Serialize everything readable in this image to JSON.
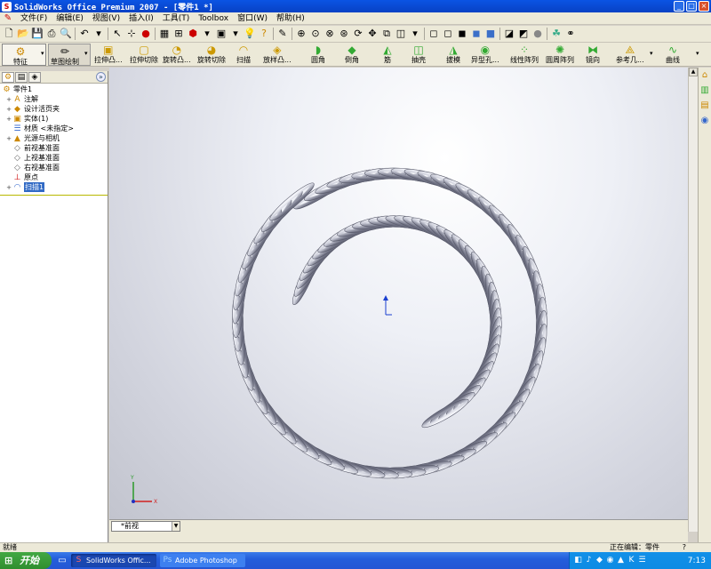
{
  "window": {
    "title": "SolidWorks Office Premium 2007 - [零件1 *]"
  },
  "menu": [
    "文件(F)",
    "编辑(E)",
    "视图(V)",
    "插入(I)",
    "工具(T)",
    "Toolbox",
    "窗口(W)",
    "帮助(H)"
  ],
  "commands": {
    "tabs": {
      "features": "特征",
      "sketch": "草图绘制"
    },
    "items": [
      {
        "label": "拉伸凸...",
        "icon": "extrude-boss-icon"
      },
      {
        "label": "拉伸切除",
        "icon": "extrude-cut-icon"
      },
      {
        "label": "旋转凸...",
        "icon": "revolve-boss-icon"
      },
      {
        "label": "旋转切除",
        "icon": "revolve-cut-icon"
      },
      {
        "label": "扫描",
        "icon": "sweep-icon"
      },
      {
        "label": "放样凸...",
        "icon": "loft-icon"
      },
      {
        "label": "圆角",
        "icon": "fillet-icon"
      },
      {
        "label": "倒角",
        "icon": "chamfer-icon"
      },
      {
        "label": "筋",
        "icon": "rib-icon"
      },
      {
        "label": "抽壳",
        "icon": "shell-icon"
      },
      {
        "label": "拔模",
        "icon": "draft-icon"
      },
      {
        "label": "异型孔...",
        "icon": "hole-wizard-icon"
      },
      {
        "label": "线性阵列",
        "icon": "linear-pattern-icon"
      },
      {
        "label": "圆周阵列",
        "icon": "circular-pattern-icon"
      },
      {
        "label": "镜向",
        "icon": "mirror-icon"
      },
      {
        "label": "参考几...",
        "icon": "reference-geometry-icon"
      },
      {
        "label": "曲线",
        "icon": "curves-icon"
      }
    ]
  },
  "tree": {
    "root": "零件1",
    "items": [
      {
        "label": "注解",
        "icon": "annotations-icon"
      },
      {
        "label": "设计活页夹",
        "icon": "design-binder-icon"
      },
      {
        "label": "实体(1)",
        "icon": "solid-bodies-icon"
      },
      {
        "label": "材质 <未指定>",
        "icon": "material-icon"
      },
      {
        "label": "光源与相机",
        "icon": "lights-cameras-icon"
      },
      {
        "label": "前视基准面",
        "icon": "plane-icon"
      },
      {
        "label": "上视基准面",
        "icon": "plane-icon"
      },
      {
        "label": "右视基准面",
        "icon": "plane-icon"
      },
      {
        "label": "原点",
        "icon": "origin-icon"
      },
      {
        "label": "扫描1",
        "icon": "sweep-feature-icon"
      }
    ]
  },
  "view": {
    "orientation": "*前视"
  },
  "status": {
    "left": "就绪",
    "right": "正在编辑：零件",
    "help": "?"
  },
  "taskbar": {
    "start": "开始",
    "tasks": [
      "SolidWorks Offic...",
      "Adobe Photoshop"
    ],
    "clock": "7:13"
  },
  "colors": {
    "titlebar": "#0a54e4",
    "spring": "#c8cad6",
    "spring_shadow": "#5a5c6c",
    "viewport_top": "#ffffff",
    "viewport_bottom": "#c2c4ce"
  }
}
